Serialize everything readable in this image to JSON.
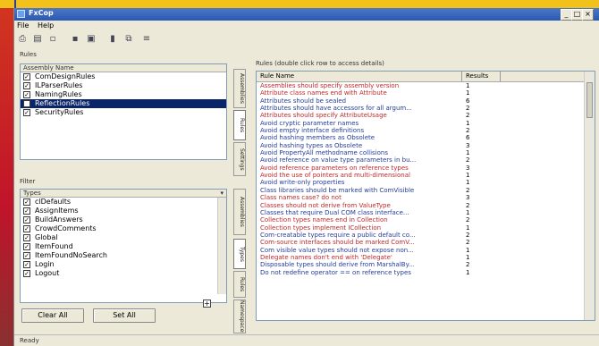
{
  "window": {
    "title": "FxCop"
  },
  "menu": {
    "file": "File",
    "help": "Help"
  },
  "toolbar": {
    "icons": [
      "new-project-icon",
      "open-icon",
      "add-icon",
      "save-icon",
      "save-as-icon",
      "analyze-icon",
      "copy-icon",
      "options-icon"
    ]
  },
  "rules_panel": {
    "label": "Rules",
    "column_header": "Assembly Name",
    "items": [
      {
        "label": "ComDesignRules",
        "checked": true,
        "selected": false
      },
      {
        "label": "ILParserRules",
        "checked": true,
        "selected": false
      },
      {
        "label": "NamingRules",
        "checked": true,
        "selected": false
      },
      {
        "label": "ReflectionRules",
        "checked": true,
        "selected": true
      },
      {
        "label": "SecurityRules",
        "checked": true,
        "selected": false
      }
    ],
    "tabs": [
      "Assemblies",
      "Rules",
      "Settings"
    ]
  },
  "filter_panel": {
    "label": "Filter",
    "dropdown_value": "Types",
    "items": [
      {
        "label": "clDefaults",
        "checked": true
      },
      {
        "label": "AssignItems",
        "checked": true
      },
      {
        "label": "BuildAnswers",
        "checked": true
      },
      {
        "label": "CrowdComments",
        "checked": true
      },
      {
        "label": "Global",
        "checked": true
      },
      {
        "label": "ItemFound",
        "checked": true
      },
      {
        "label": "ItemFoundNoSearch",
        "checked": true
      },
      {
        "label": "Login",
        "checked": true
      },
      {
        "label": "Logout",
        "checked": true
      }
    ],
    "tabs": [
      "Assemblies",
      "Types",
      "Rules",
      "Namespaces"
    ],
    "clear_all": "Clear All",
    "set_all": "Set All"
  },
  "results": {
    "label": "Rules (double click row to access details)",
    "col_name": "Rule Name",
    "col_count": "Results",
    "rows": [
      {
        "name": "Assemblies should specify assembly version",
        "count": "1",
        "color": "red"
      },
      {
        "name": "Attribute class names end with Attribute",
        "count": "1",
        "color": "red"
      },
      {
        "name": "Attributes should be sealed",
        "count": "6",
        "color": "blue"
      },
      {
        "name": "Attributes should have accessors for all argum...",
        "count": "2",
        "color": "blue"
      },
      {
        "name": "Attributes should specify AttributeUsage",
        "count": "2",
        "color": "red"
      },
      {
        "name": "Avoid cryptic parameter names",
        "count": "1",
        "color": "blue"
      },
      {
        "name": "Avoid empty interface definitions",
        "count": "2",
        "color": "blue"
      },
      {
        "name": "Avoid hashing members as Obsolete",
        "count": "6",
        "color": "blue"
      },
      {
        "name": "Avoid hashing types as Obsolete",
        "count": "3",
        "color": "blue"
      },
      {
        "name": "Avoid PropertyAll methodname collisions",
        "count": "1",
        "color": "blue"
      },
      {
        "name": "Avoid reference on value type parameters in bu...",
        "count": "2",
        "color": "blue"
      },
      {
        "name": "Avoid reference parameters on reference types",
        "count": "3",
        "color": "red"
      },
      {
        "name": "Avoid the use of pointers and multi-dimensional",
        "count": "1",
        "color": "red"
      },
      {
        "name": "Avoid write-only properties",
        "count": "1",
        "color": "blue"
      },
      {
        "name": "Class libraries should be marked with ComVisible",
        "count": "2",
        "color": "blue"
      },
      {
        "name": "Class names case? do not",
        "count": "3",
        "color": "red"
      },
      {
        "name": "Classes should not derive from ValueType",
        "count": "2",
        "color": "red"
      },
      {
        "name": "Classes that require Dual COM class interface...",
        "count": "1",
        "color": "blue"
      },
      {
        "name": "Collection types names end in Collection",
        "count": "2",
        "color": "red"
      },
      {
        "name": "Collection types implement ICollection",
        "count": "1",
        "color": "red"
      },
      {
        "name": "Com-creatable types require a public default co...",
        "count": "2",
        "color": "blue"
      },
      {
        "name": "Com-source interfaces should be marked ComV...",
        "count": "2",
        "color": "red"
      },
      {
        "name": "Com visible value types should not expose non...",
        "count": "1",
        "color": "blue"
      },
      {
        "name": "Delegate names don't end with 'Delegate'",
        "count": "1",
        "color": "red"
      },
      {
        "name": "Disposable types should derive from MarshalBy...",
        "count": "2",
        "color": "blue"
      },
      {
        "name": "Do not redefine operator == on reference types",
        "count": "1",
        "color": "blue"
      }
    ]
  },
  "status": {
    "text": "Ready"
  }
}
